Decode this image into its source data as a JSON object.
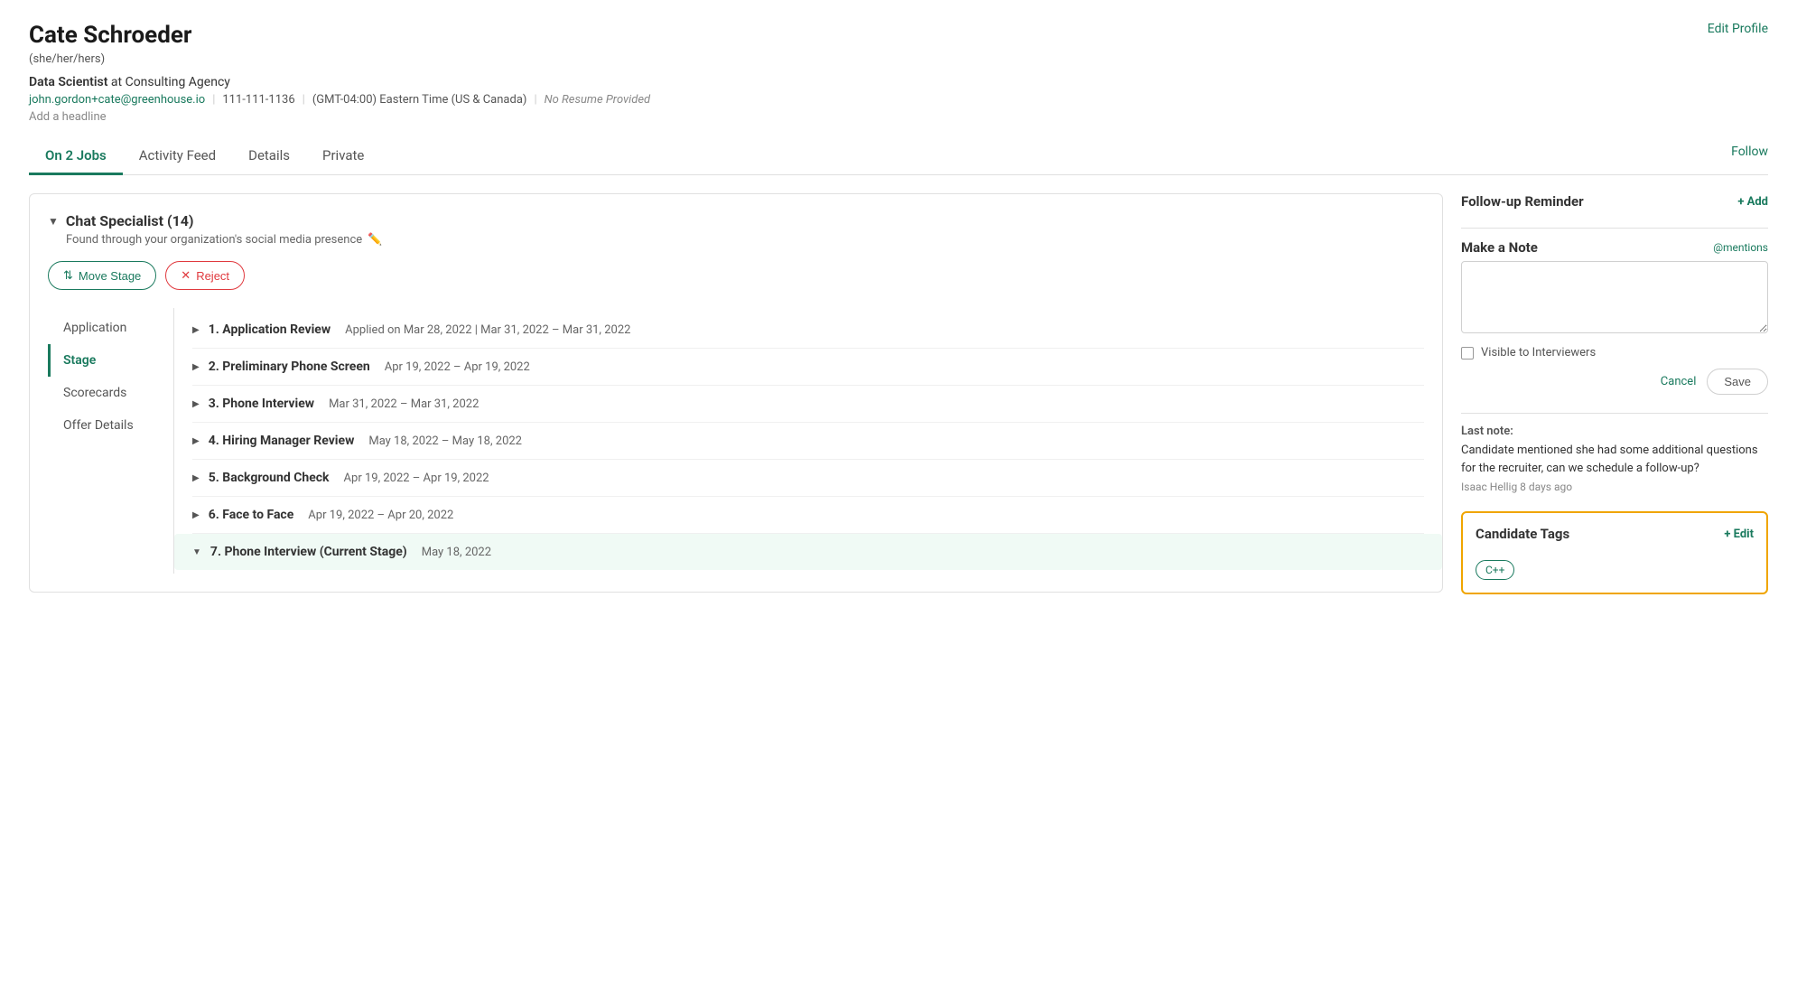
{
  "header": {
    "name": "Cate Schroeder",
    "pronouns": "(she/her/hers)",
    "title": "Data Scientist",
    "company": "Consulting Agency",
    "email": "john.gordon+cate@greenhouse.io",
    "phone": "111-111-1136",
    "timezone": "(GMT-04:00) Eastern Time (US & Canada)",
    "no_resume": "No Resume Provided",
    "add_headline": "Add a headline",
    "edit_profile": "Edit Profile"
  },
  "tabs": {
    "on_jobs": "On 2 Jobs",
    "activity_feed": "Activity Feed",
    "details": "Details",
    "private": "Private",
    "follow": "Follow"
  },
  "job_card": {
    "title": "Chat Specialist (14)",
    "source": "Found through your organization's social media presence",
    "move_stage_label": "Move Stage",
    "reject_label": "Reject"
  },
  "stage_nav": [
    {
      "label": "Application",
      "active": false
    },
    {
      "label": "Stage",
      "active": true
    },
    {
      "label": "Scorecards",
      "active": false
    },
    {
      "label": "Offer Details",
      "active": false
    }
  ],
  "stages": [
    {
      "number": "1.",
      "name": "Application Review",
      "dates": "Applied on Mar 28, 2022 | Mar 31, 2022 – Mar 31, 2022",
      "expanded": false,
      "current": false
    },
    {
      "number": "2.",
      "name": "Preliminary Phone Screen",
      "dates": "Apr 19, 2022 – Apr 19, 2022",
      "expanded": false,
      "current": false
    },
    {
      "number": "3.",
      "name": "Phone Interview",
      "dates": "Mar 31, 2022 – Mar 31, 2022",
      "expanded": false,
      "current": false
    },
    {
      "number": "4.",
      "name": "Hiring Manager Review",
      "dates": "May 18, 2022 – May 18, 2022",
      "expanded": false,
      "current": false
    },
    {
      "number": "5.",
      "name": "Background Check",
      "dates": "Apr 19, 2022 – Apr 19, 2022",
      "expanded": false,
      "current": false
    },
    {
      "number": "6.",
      "name": "Face to Face",
      "dates": "Apr 19, 2022 – Apr 20, 2022",
      "expanded": false,
      "current": false
    },
    {
      "number": "7.",
      "name": "Phone Interview (Current Stage)",
      "dates": "May 18, 2022",
      "expanded": true,
      "current": true
    }
  ],
  "right_panel": {
    "followup_title": "Follow-up Reminder",
    "add_label": "+ Add",
    "make_note_title": "Make a Note",
    "mentions_label": "@mentions",
    "note_placeholder": "",
    "visible_label": "Visible to Interviewers",
    "cancel_label": "Cancel",
    "save_label": "Save",
    "last_note_label": "Last note:",
    "last_note_text": "Candidate mentioned she had some additional questions for the recruiter, can we schedule a follow-up?",
    "last_note_meta": "Isaac Hellig 8 days ago",
    "candidate_tags_title": "Candidate Tags",
    "edit_tags_label": "+ Edit",
    "tags": [
      "C++"
    ]
  }
}
